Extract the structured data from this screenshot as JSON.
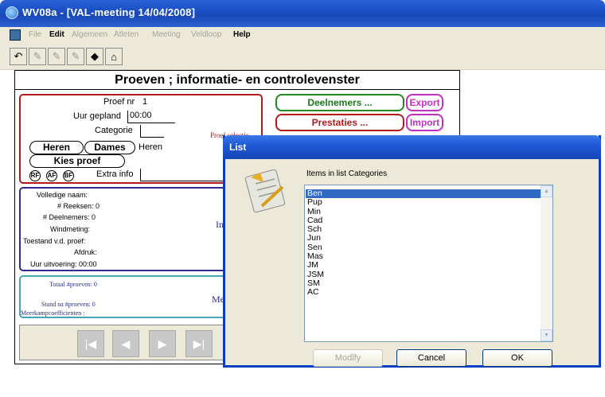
{
  "window": {
    "title": "WV08a - [VAL-meeting 14/04/2008]"
  },
  "menu": [
    "File",
    "Edit",
    "Algemeen",
    "Atleten",
    "Meeting",
    "Veldloop",
    "Help"
  ],
  "main": {
    "heading": "Proeven ; informatie- en controlevenster",
    "proef_nr_label": "Proef nr",
    "proef_nr_value": "1",
    "uur_gepland_label": "Uur gepland",
    "uur_gepland_value": "00:00",
    "categorie_label": "Categorie",
    "btn_heren": "Heren",
    "btn_dames": "Dames",
    "gender_value": "Heren",
    "btn_kies_proef": "Kies proef",
    "round_rf": "RF",
    "round_af": "AF",
    "round_bf": "BF",
    "extra_info_label": "Extra info",
    "proef_selectie_label": "Proef selectie",
    "btn_deelnemers": "Deelnemers ...",
    "btn_prestaties": "Prestaties ...",
    "btn_export": "Export",
    "btn_import": "Import",
    "info": {
      "volledige_naam": "Volledige naam:",
      "reeksen": "# Reeksen: 0",
      "deelnemers": "# Deelnemers: 0",
      "windmeting": "Windmeting:",
      "toestand": "Toestand v.d. proef:",
      "afdruk": "Afdruk:",
      "uur_uitvoering": "Uur uitvoering: 00:00",
      "side_text": "In"
    },
    "totals": {
      "totaal": "Totaal #proeven: 0",
      "stand": "Stand na #proeven: 0",
      "meerkamp": "Meerkampcoefficienten :",
      "side_text": "Me"
    }
  },
  "dialog": {
    "title": "List",
    "label": "Items in list Categories",
    "items": [
      "Ben",
      "Pup",
      "Min",
      "Cad",
      "Sch",
      "Jun",
      "Sen",
      "Mas",
      "JM",
      "JSM",
      "SM",
      "AC"
    ],
    "selected_index": 0,
    "btn_modify": "Modify",
    "btn_cancel": "Cancel",
    "btn_ok": "OK"
  },
  "colors": {
    "titlebar": "#1b4fc4",
    "selection": "#316ac5",
    "red": "#b31b1b",
    "green": "#1f8a1f",
    "magenta": "#c030c0"
  }
}
